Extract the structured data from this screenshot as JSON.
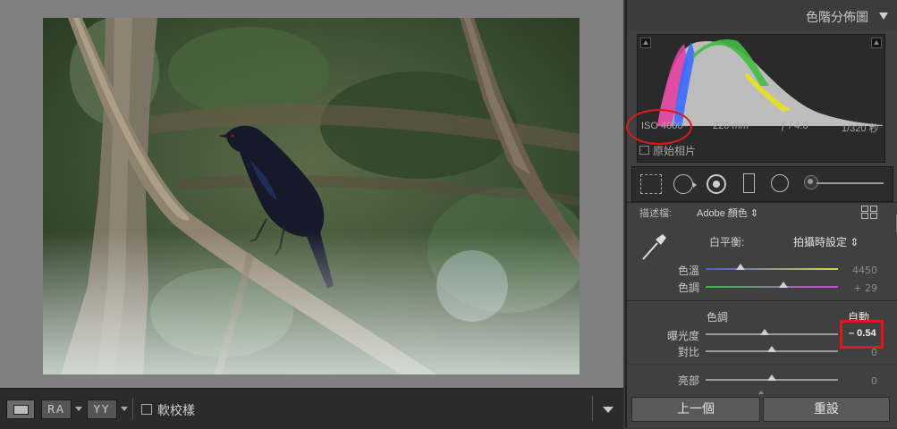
{
  "histogram": {
    "title": "色階分佈圖",
    "iso": "ISO 4000",
    "focal": "220 mm",
    "aperture": "ƒ / 4.0",
    "shutter": "1/320 秒",
    "original_photo_label": "原始相片"
  },
  "profile": {
    "label": "描述檔:",
    "value": "Adobe 顏色 ⇕"
  },
  "white_balance": {
    "label": "白平衡:",
    "value": "拍攝時設定 ⇕"
  },
  "temp": {
    "label": "色溫",
    "value": "4450"
  },
  "tint": {
    "label": "色調",
    "value": "+ 29"
  },
  "tone": {
    "label": "色調",
    "auto": "自動"
  },
  "exposure": {
    "label": "曝光度",
    "value": "– 0.54"
  },
  "contrast": {
    "label": "對比",
    "value": "0"
  },
  "highlights": {
    "label": "亮部",
    "value": "0"
  },
  "buttons": {
    "previous": "上一個",
    "reset": "重設"
  },
  "toolbar": {
    "soft_proof": "軟校樣"
  },
  "colors": {
    "accent_red": "#e01818",
    "panel": "#404040"
  }
}
